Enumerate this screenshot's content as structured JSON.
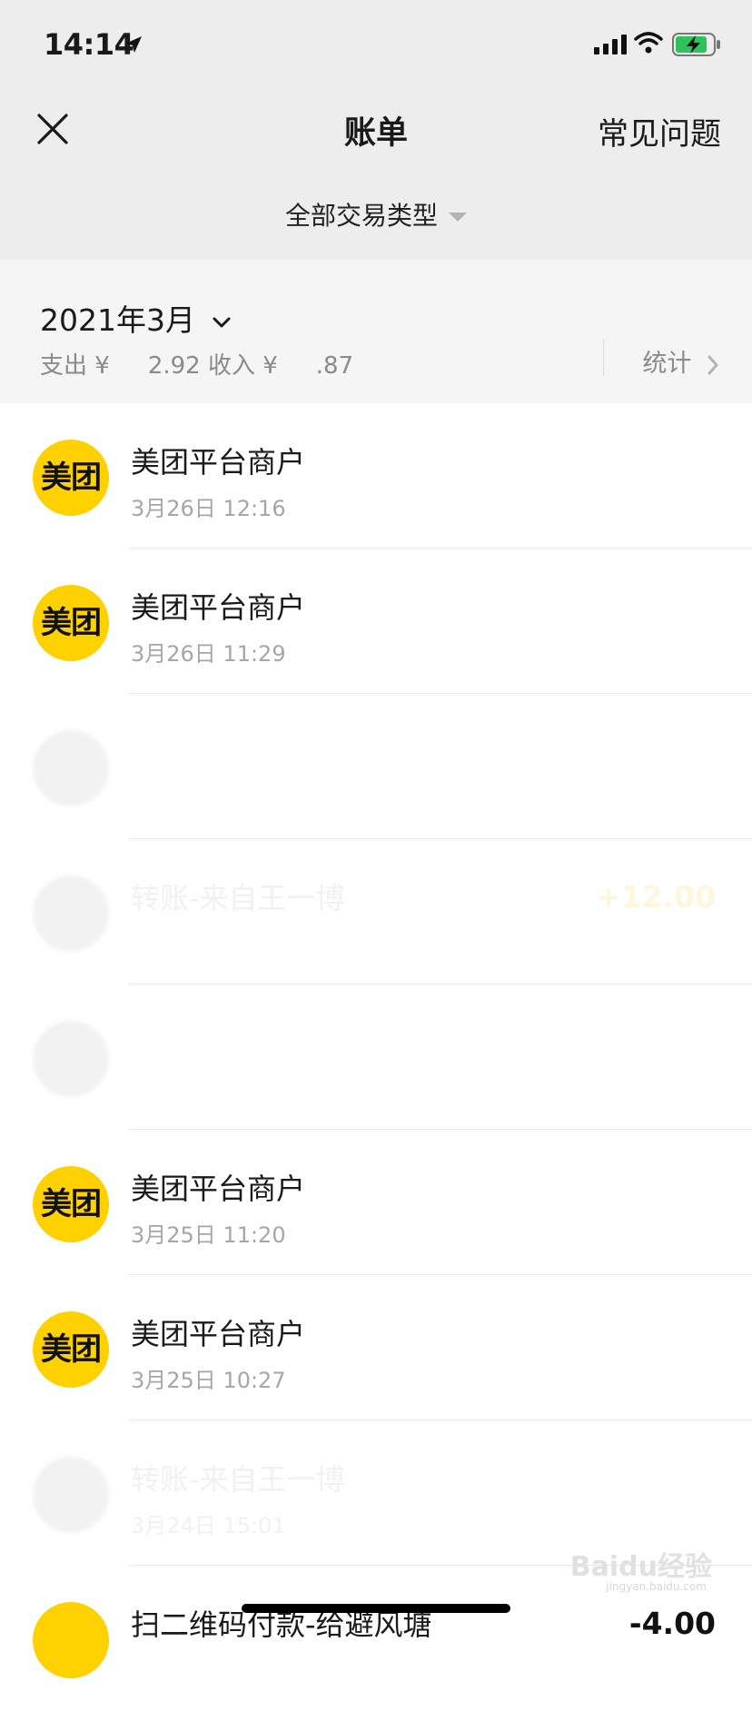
{
  "status_bar": {
    "time": "14:14",
    "icons": [
      "location-arrow-icon",
      "cellular-signal-icon",
      "wifi-icon",
      "battery-charging-icon"
    ]
  },
  "nav": {
    "title": "账单",
    "faq_label": "常见问题",
    "close_icon": "close-icon",
    "filter_label": "全部交易类型"
  },
  "month_bar": {
    "month": "2021年3月",
    "expense_label": "支出 ¥",
    "expense_visible": "2.92",
    "income_label": "收入 ¥",
    "income_visible": ".87",
    "stats_label": "统计"
  },
  "transactions": [
    {
      "merchant": "美团平台商户",
      "datetime": "3月26日 12:16",
      "amount": "",
      "logo_text": "美团"
    },
    {
      "merchant": "美团平台商户",
      "datetime": "3月26日 11:29",
      "amount": "",
      "logo_text": "美团"
    },
    {
      "merchant": "",
      "datetime": "",
      "amount": "",
      "logo_text": ""
    },
    {
      "merchant": "转账-来自王一博",
      "datetime": "",
      "amount": "+12.00",
      "logo_text": ""
    },
    {
      "merchant": "",
      "datetime": "",
      "amount": "",
      "logo_text": ""
    },
    {
      "merchant": "美团平台商户",
      "datetime": "3月25日 11:20",
      "amount": "",
      "logo_text": "美团"
    },
    {
      "merchant": "美团平台商户",
      "datetime": "3月25日 10:27",
      "amount": "",
      "logo_text": "美团"
    },
    {
      "merchant": "转账-来自王一博",
      "datetime": "3月24日 15:01",
      "amount": "",
      "logo_text": ""
    },
    {
      "merchant": "扫二维码付款-给避风塘",
      "datetime": "",
      "amount": "-4.00",
      "logo_text": ""
    }
  ],
  "watermark": {
    "text": "Baidu经验",
    "sub": "jingyan.baidu.com"
  },
  "colors": {
    "header_bg": "#ededed",
    "month_bar_bg": "#f5f5f5",
    "meituan_yellow": "#ffd100"
  }
}
